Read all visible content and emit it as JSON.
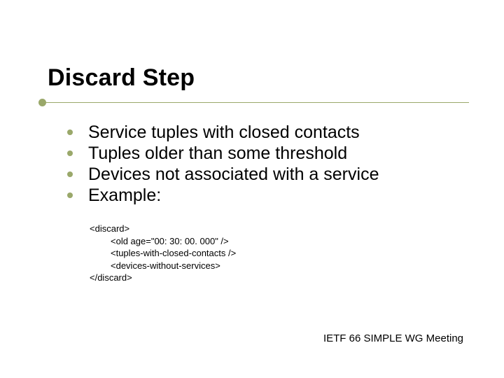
{
  "title": "Discard Step",
  "bullets": [
    "Service tuples with closed contacts",
    "Tuples older than some threshold",
    "Devices not associated with a service",
    "Example:"
  ],
  "code": {
    "l1": "<discard>",
    "l2": "<old age=\"00: 30: 00. 000\" />",
    "l3": "<tuples-with-closed-contacts />",
    "l4": "<devices-without-services>",
    "l5": "</discard>"
  },
  "footer": "IETF 66 SIMPLE WG Meeting"
}
